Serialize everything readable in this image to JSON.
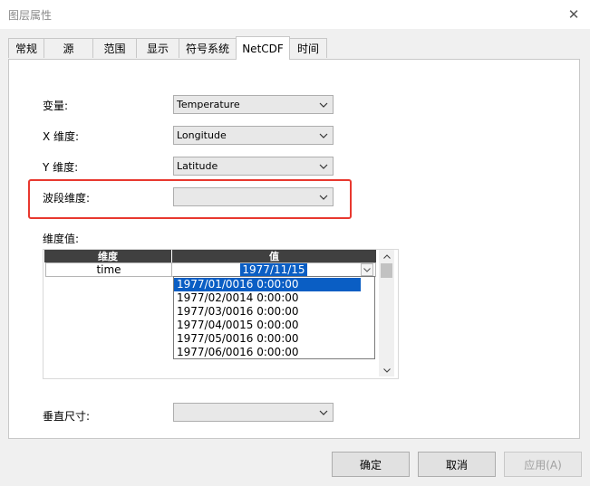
{
  "window": {
    "title": "图层属性",
    "close_symbol": "✕"
  },
  "tabs": [
    {
      "label": "常规"
    },
    {
      "label": "源"
    },
    {
      "label": "范围"
    },
    {
      "label": "显示"
    },
    {
      "label": "符号系统"
    },
    {
      "label": "NetCDF",
      "active": true
    },
    {
      "label": "时间"
    }
  ],
  "form": {
    "variable": {
      "label": "变量:",
      "value": "Temperature"
    },
    "x_dim": {
      "label": "X 维度:",
      "value": "Longitude"
    },
    "y_dim": {
      "label": "Y 维度:",
      "value": "Latitude"
    },
    "band_dim": {
      "label": "波段维度:",
      "value": ""
    },
    "dim_values_label": "维度值:",
    "vertical": {
      "label": "垂直尺寸:",
      "value": ""
    }
  },
  "grid": {
    "headers": [
      "维度",
      "值"
    ],
    "row": {
      "dimension": "time",
      "value": "1977/11/15"
    }
  },
  "dropdown": {
    "items": [
      "1977/01/0016 0:00:00",
      "1977/02/0014 0:00:00",
      "1977/03/0016 0:00:00",
      "1977/04/0015 0:00:00",
      "1977/05/0016 0:00:00",
      "1977/06/0016 0:00:00"
    ],
    "selected_index": 0
  },
  "buttons": {
    "ok": "确定",
    "cancel": "取消",
    "apply": "应用(A)"
  },
  "colors": {
    "highlight": "#e8382f",
    "selection": "#0a5ec4",
    "grid_header": "#404040"
  }
}
